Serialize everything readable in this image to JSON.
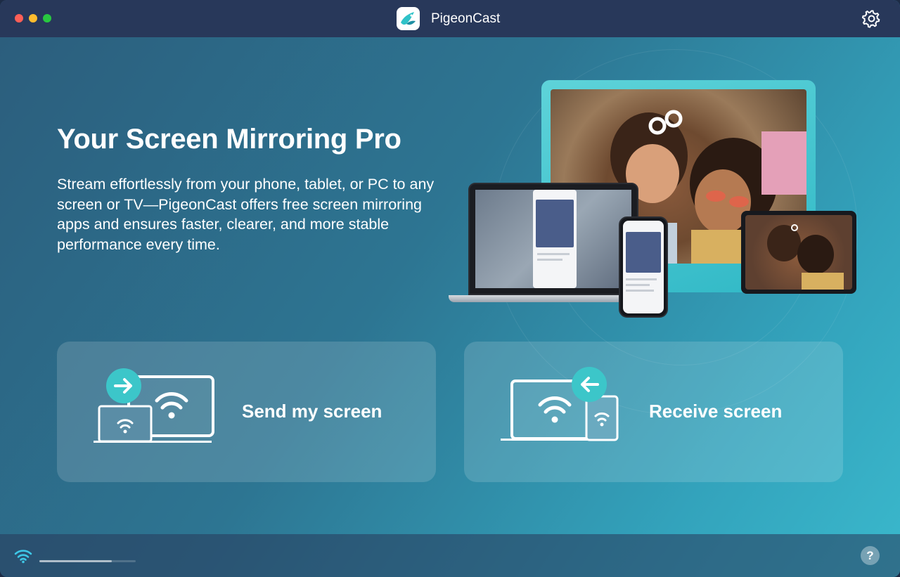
{
  "window": {
    "title": "PigeonCast"
  },
  "hero": {
    "headline": "Your Screen Mirroring Pro",
    "description": "Stream effortlessly from your phone, tablet, or PC to any screen or TV—PigeonCast offers free screen mirroring apps and ensures faster, clearer, and more stable performance every time."
  },
  "actions": {
    "send_label": "Send my screen",
    "receive_label": "Receive screen"
  },
  "footer": {
    "help_label": "?",
    "connection_progress": 0.75
  },
  "icons": {
    "settings": "gear-icon",
    "status": "wifi-icon",
    "send": "send-screen-icon",
    "receive": "receive-screen-icon"
  },
  "colors": {
    "titlebar": "#28385a",
    "accent": "#3cc6c9",
    "gradient_start": "#2c5d7c",
    "gradient_end": "#3ab8cc"
  }
}
